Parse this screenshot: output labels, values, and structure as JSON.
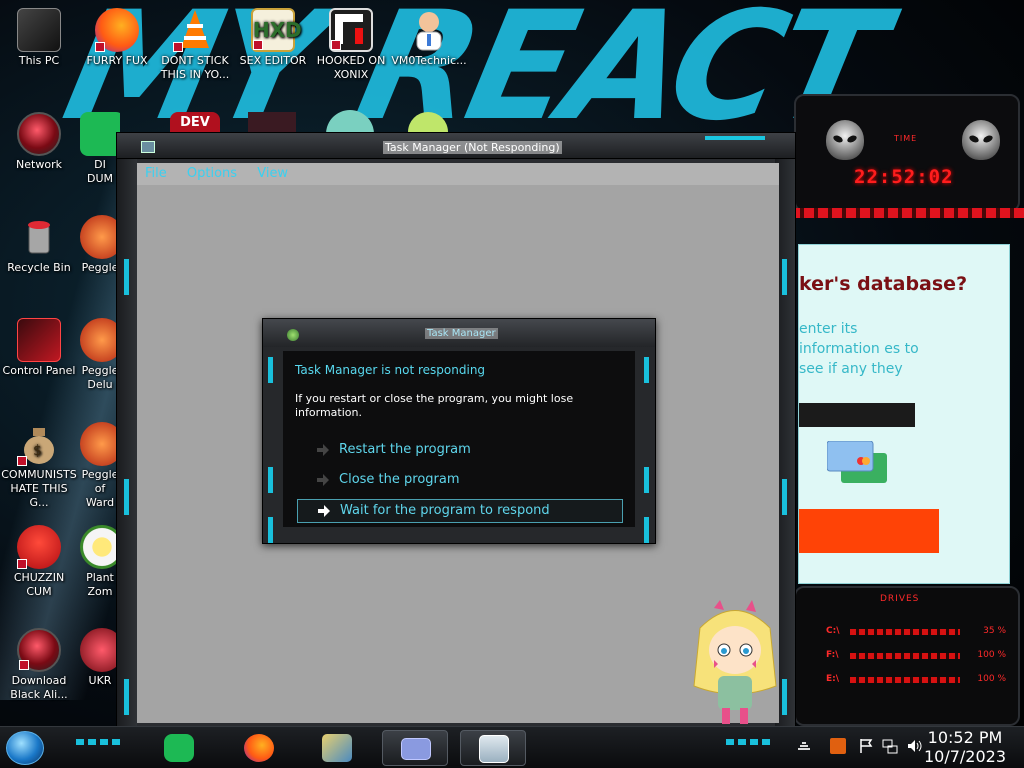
{
  "desktop": {
    "icons": [
      {
        "id": "this-pc",
        "label": "This PC"
      },
      {
        "id": "furry-fux",
        "label": "FURRY FUX"
      },
      {
        "id": "dont-stick",
        "label": "DONT STICK THIS IN YO..."
      },
      {
        "id": "sex-editor",
        "label": "SEX EDITOR"
      },
      {
        "id": "hooked-on-xonix",
        "label": "HOOKED ON XONIX"
      },
      {
        "id": "vm0technic",
        "label": "VM0Technic..."
      },
      {
        "id": "network",
        "label": "Network"
      },
      {
        "id": "recycle-bin",
        "label": "Recycle Bin"
      },
      {
        "id": "control-panel",
        "label": "Control Panel"
      },
      {
        "id": "communists",
        "label": "COMMUNISTS HATE THIS G..."
      },
      {
        "id": "chuzzin",
        "label": "CHUZZIN CUM"
      },
      {
        "id": "download-black",
        "label": "Download Black Ali..."
      },
      {
        "id": "peggle",
        "label": "Peggle"
      },
      {
        "id": "peggle-deluxe",
        "label": "Peggle Delu"
      },
      {
        "id": "peggle-nights",
        "label": "Peggle of Ward"
      },
      {
        "id": "plants-zombies",
        "label": "Plant Zom"
      },
      {
        "id": "ukr",
        "label": "UKR"
      },
      {
        "id": "di-dum",
        "label": "DI DUM"
      }
    ],
    "icon_badge": "DEV"
  },
  "task_manager": {
    "title": "Task Manager (Not Responding)",
    "menu": [
      "File",
      "Options",
      "View"
    ]
  },
  "dialog": {
    "title": "Task Manager",
    "heading": "Task Manager is not responding",
    "message": "If you restart or close the program, you might lose information.",
    "options": [
      {
        "label": "Restart the program",
        "selected": false
      },
      {
        "label": "Close the program",
        "selected": false
      },
      {
        "label": "Wait for the program to respond",
        "selected": true
      }
    ]
  },
  "gadget": {
    "time_label": "TIME",
    "time": "22:52:02",
    "phish_question": "ker's database?",
    "phish_text": "enter its information es to see if any they",
    "drives_title": "DRIVES",
    "drives": [
      {
        "letter": "C:\\",
        "pct": "35 %"
      },
      {
        "letter": "F:\\",
        "pct": "100 %"
      },
      {
        "letter": "E:\\",
        "pct": "100 %"
      }
    ]
  },
  "taskbar": {
    "clock_time": "10:52 PM",
    "clock_date": "10/7/2023",
    "pinned": [
      "spotify",
      "firefox",
      "media-player",
      "phishing-app",
      "task-manager"
    ]
  },
  "colors": {
    "accent_cyan": "#19c0dc",
    "link_cyan": "#5fd6ec",
    "gadget_red": "#ff1d1d",
    "phish_button": "#ff4306"
  }
}
